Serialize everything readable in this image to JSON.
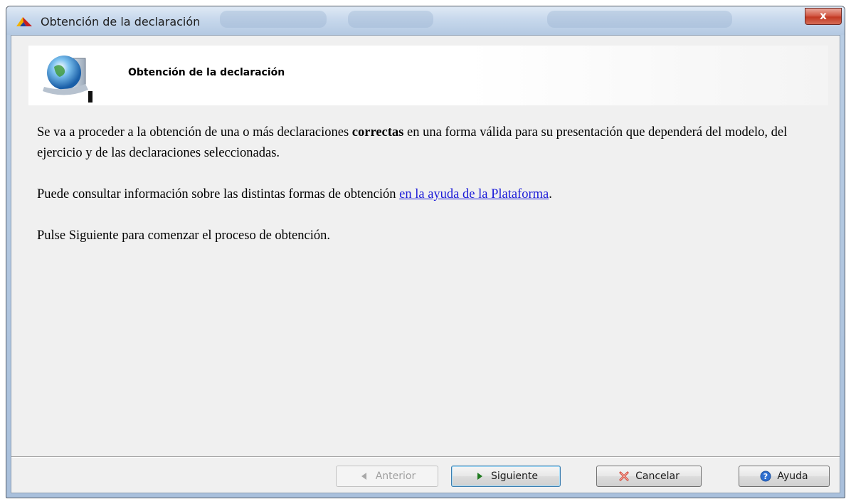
{
  "window": {
    "title": "Obtención de la declaración",
    "close_label": "x"
  },
  "header": {
    "title": "Obtención de la declaración"
  },
  "body": {
    "p1_before": "Se va a proceder a la obtención de una o más declaraciones ",
    "p1_bold": "correctas",
    "p1_after": " en una forma válida para su presentación que dependerá del modelo, del ejercicio y de las declaraciones seleccionadas.",
    "p2_before": "Puede consultar información sobre las distintas formas de obtención ",
    "p2_link": "en la ayuda de la Plataforma",
    "p2_after": ".",
    "p3": "Pulse Siguiente para comenzar el proceso de obtención."
  },
  "buttons": {
    "previous": {
      "label": "Anterior",
      "icon": "arrow-left-icon",
      "enabled": false
    },
    "next": {
      "label": "Siguiente",
      "icon": "arrow-right-icon",
      "enabled": true
    },
    "cancel": {
      "label": "Cancelar",
      "icon": "cancel-icon",
      "enabled": true
    },
    "help": {
      "label": "Ayuda",
      "icon": "help-icon",
      "enabled": true
    }
  },
  "colors": {
    "link": "#1a1ad8",
    "close": "#c94a34",
    "next_arrow": "#2e8a2e"
  }
}
